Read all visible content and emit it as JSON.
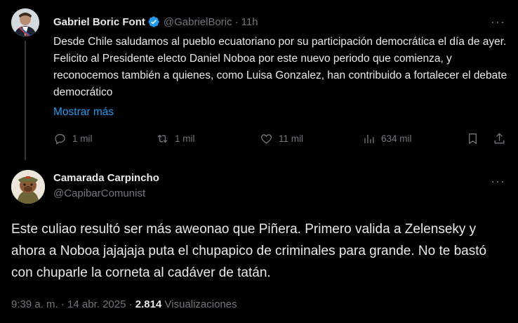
{
  "tweet": {
    "author_name": "Gabriel Boric Font",
    "handle": "@GabrielBoric",
    "time": "11h",
    "text": "Desde Chile saludamos al pueblo ecuatoriano por su participación democrática el día de ayer. Felicito al Presidente electo Daniel Noboa por este nuevo periodo que comienza, y reconocemos también a quienes, como Luisa Gonzalez, han contribuido a fortalecer el debate democrático",
    "show_more": "Mostrar más",
    "replies": "1 mil",
    "reposts": "1 mil",
    "likes": "11 mil",
    "views": "634 mil"
  },
  "reply": {
    "author_name": "Camarada Carpincho",
    "handle": "@CapibarComunist",
    "text": "Este culiao resultó ser más aweonao que Piñera. Primero valida a Zelenseky y ahora a Noboa jajajaja puta el chupapico de criminales para grande. No te bastó con chuparle la corneta al cadáver de tatán.",
    "timestamp": "9:39 a. m. · 14 abr. 2025 · ",
    "views_count": "2.814",
    "views_label": "Visualizaciones"
  },
  "colors": {
    "background": "#000000",
    "text": "#e7e9ea",
    "muted": "#71767b",
    "link": "#1d9bf0",
    "verified": "#1d9bf0"
  },
  "icons": [
    "verified-badge-icon",
    "more-icon",
    "reply-icon",
    "repost-icon",
    "like-icon",
    "views-icon",
    "bookmark-icon",
    "share-icon"
  ]
}
